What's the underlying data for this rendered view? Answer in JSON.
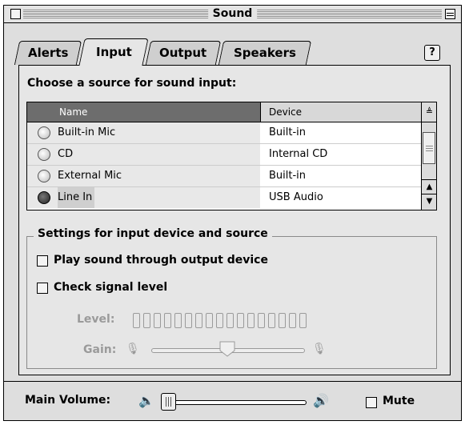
{
  "window": {
    "title": "Sound"
  },
  "tabs": [
    {
      "label": "Alerts",
      "active": false
    },
    {
      "label": "Input",
      "active": true
    },
    {
      "label": "Output",
      "active": false
    },
    {
      "label": "Speakers",
      "active": false
    }
  ],
  "help_button": {
    "label": "?"
  },
  "input": {
    "heading": "Choose a source for sound input:",
    "columns": {
      "name": "Name",
      "device": "Device"
    },
    "rows": [
      {
        "name": "Built-in Mic",
        "device": "Built-in",
        "selected": false
      },
      {
        "name": "CD",
        "device": "Internal CD",
        "selected": false
      },
      {
        "name": "External Mic",
        "device": "Built-in",
        "selected": false
      },
      {
        "name": "Line In",
        "device": "USB Audio",
        "selected": true
      }
    ]
  },
  "settings": {
    "group_label": "Settings for input device and source",
    "play_through_label": "Play sound through output device",
    "play_through_checked": false,
    "check_signal_label": "Check signal level",
    "check_signal_checked": false,
    "level_label": "Level:",
    "level_cells": 17,
    "gain_label": "Gain:",
    "gain_value": 0.5
  },
  "bottom": {
    "main_volume_label": "Main Volume:",
    "volume_value": 0.02,
    "mute_label": "Mute",
    "mute_checked": false
  },
  "colors": {
    "header_active": "#6d6d6d",
    "disabled_text": "#9a9a9a"
  }
}
